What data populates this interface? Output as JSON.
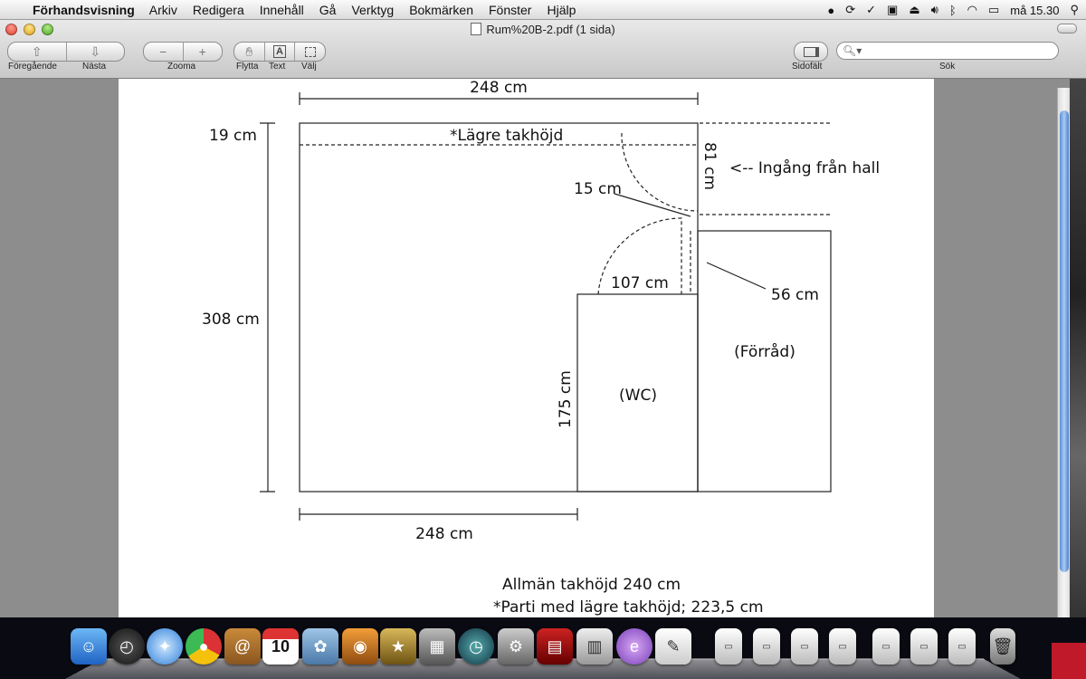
{
  "menubar": {
    "app_name": "Förhandsvisning",
    "items": [
      "Arkiv",
      "Redigera",
      "Innehåll",
      "Gå",
      "Verktyg",
      "Bokmärken",
      "Fönster",
      "Hjälp"
    ],
    "clock": "må 15.30"
  },
  "window": {
    "title": "Rum%20B-2.pdf (1 sida)"
  },
  "toolbar": {
    "prev_label": "Föregående",
    "next_label": "Nästa",
    "zoom_label": "Zooma",
    "move_label": "Flytta",
    "text_label": "Text",
    "select_label": "Välj",
    "sidebar_label": "Sidofält",
    "search_label": "Sök"
  },
  "floorplan": {
    "top_width": "248 cm",
    "low_ceiling_depth": "19 cm",
    "low_ceiling_note": "*Lägre takhöjd",
    "room_depth": "308 cm",
    "entrance_width": "81 cm",
    "entrance_label": "<-- Ingång från hall",
    "wall_gap": "15 cm",
    "wc_door_width": "107 cm",
    "storage_offset": "56 cm",
    "wc_depth": "175 cm",
    "wc_label": "(WC)",
    "storage_label": "(Förråd)",
    "bottom_width": "248 cm",
    "ceiling_general": "Allmän takhöjd 240 cm",
    "ceiling_low": "*Parti med lägre takhöjd; 223,5 cm"
  },
  "dock": {
    "apps": [
      "Finder",
      "Dashboard",
      "Safari",
      "Google Chrome",
      "Adressbok",
      "iCal",
      "iPhoto",
      "Förhandsvisning",
      "iMovie",
      "Systeminställningar",
      "Time Machine",
      "Photo Booth",
      "Systeminställningar",
      "Mail",
      "TextEdit"
    ]
  }
}
